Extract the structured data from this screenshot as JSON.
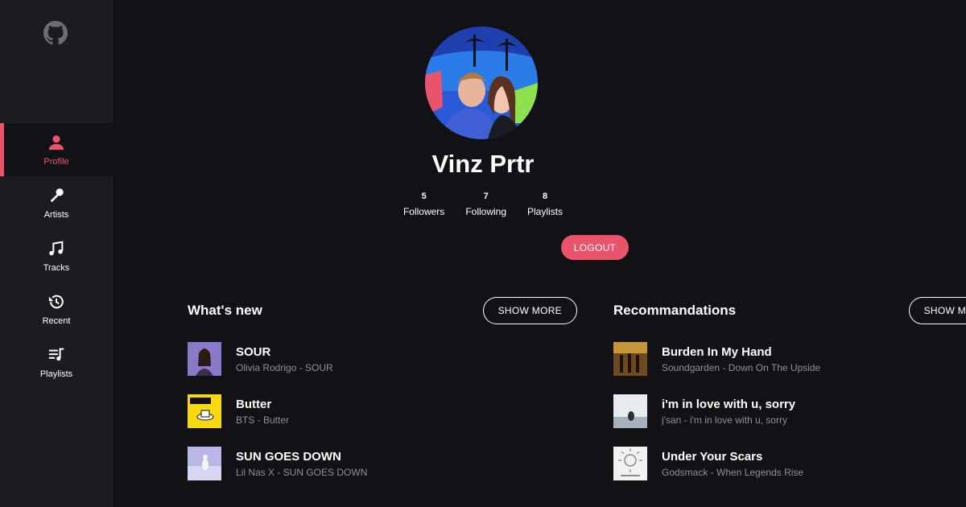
{
  "sidebar": {
    "items": [
      {
        "label": "Profile",
        "icon": "user-icon",
        "active": true
      },
      {
        "label": "Artists",
        "icon": "microphone-icon"
      },
      {
        "label": "Tracks",
        "icon": "music-note-icon"
      },
      {
        "label": "Recent",
        "icon": "history-icon"
      },
      {
        "label": "Playlists",
        "icon": "playlist-icon"
      }
    ]
  },
  "profile": {
    "name": "Vinz Prtr",
    "stats": [
      {
        "value": "5",
        "label": "Followers"
      },
      {
        "value": "7",
        "label": "Following"
      },
      {
        "value": "8",
        "label": "Playlists"
      }
    ],
    "logout_label": "LOGOUT"
  },
  "whats_new": {
    "title": "What's new",
    "show_more": "SHOW MORE",
    "tracks": [
      {
        "title": "SOUR",
        "subtitle": "Olivia Rodrigo - SOUR"
      },
      {
        "title": "Butter",
        "subtitle": "BTS - Butter"
      },
      {
        "title": "SUN GOES DOWN",
        "subtitle": "Lil Nas X - SUN GOES DOWN"
      }
    ]
  },
  "recommendations": {
    "title": "Recommandations",
    "show_more": "SHOW MORE",
    "tracks": [
      {
        "title": "Burden In My Hand",
        "subtitle": "Soundgarden - Down On The Upside"
      },
      {
        "title": "i'm in love with u, sorry",
        "subtitle": "j'san - i'm in love with u, sorry"
      },
      {
        "title": "Under Your Scars",
        "subtitle": "Godsmack - When Legends Rise"
      }
    ]
  },
  "colors": {
    "accent": "#e9536b",
    "background": "#121216",
    "sidebar": "#1b1c22"
  }
}
